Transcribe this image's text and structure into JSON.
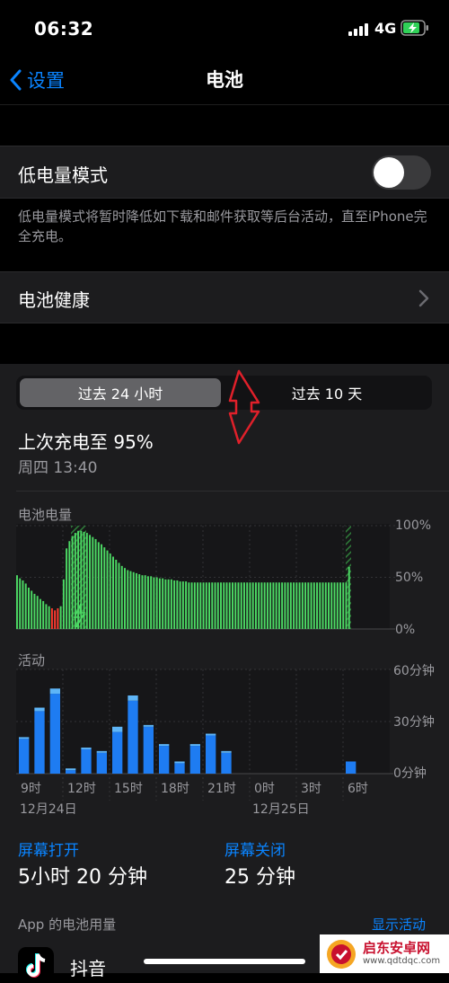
{
  "status_bar": {
    "time": "06:32",
    "network": "4G",
    "battery_icon": "battery-charging-icon",
    "battery_color": "#30d158"
  },
  "nav": {
    "back_label": "设置",
    "title": "电池",
    "accent": "#0a84ff"
  },
  "low_power": {
    "label": "低电量模式",
    "enabled": false,
    "footnote": "低电量模式将暂时降低如下载和邮件获取等后台活动，直至iPhone完全充电。"
  },
  "battery_health": {
    "label": "电池健康"
  },
  "segments": {
    "options": [
      "过去 24 小时",
      "过去 10 天"
    ],
    "selected": 0
  },
  "last_charge": {
    "title": "上次充电至 95%",
    "time": "周四 13:40"
  },
  "battery_chart": {
    "label": "电池电量",
    "y_ticks": [
      "100%",
      "50%",
      "0%"
    ],
    "colors": {
      "normal": "#4cd964",
      "low": "#ff3b30"
    },
    "chart_data": {
      "type": "bar",
      "ylim": [
        0,
        100
      ],
      "values": [
        52,
        49,
        47,
        44,
        40,
        37,
        34,
        32,
        29,
        27,
        24,
        22,
        20,
        18,
        20,
        22,
        48,
        78,
        85,
        90,
        93,
        95,
        95,
        94,
        93,
        91,
        89,
        87,
        84,
        82,
        79,
        76,
        73,
        70,
        67,
        64,
        61,
        59,
        57,
        56,
        55,
        54,
        53,
        52,
        52,
        51,
        51,
        50,
        50,
        49,
        49,
        48,
        48,
        48,
        47,
        47,
        46,
        46,
        46,
        45,
        45,
        45,
        45,
        45,
        45,
        45,
        45,
        45,
        45,
        45,
        45,
        45,
        45,
        45,
        45,
        45,
        45,
        45,
        45,
        45,
        45,
        45,
        45,
        45,
        45,
        45,
        45,
        45,
        45,
        45,
        45,
        45,
        45,
        45,
        45,
        45,
        45,
        45,
        45,
        45,
        45,
        45,
        45,
        45,
        45,
        45,
        45,
        45,
        45,
        45,
        45,
        45,
        45,
        45,
        60
      ],
      "low_threshold": 20
    }
  },
  "activity_chart": {
    "label": "活动",
    "y_ticks": [
      "60分钟",
      "30分钟",
      "0分钟"
    ],
    "colors": {
      "screen_on": "#1e7cf2",
      "screen_off": "#5eb5f7"
    },
    "x_labels": [
      "9时",
      "12时",
      "15时",
      "18时",
      "21时",
      "0时",
      "3时",
      "6时"
    ],
    "date_labels": [
      "12月24日",
      "12月25日"
    ],
    "chart_data": {
      "type": "bar",
      "ylim": [
        0,
        60
      ],
      "x": [
        "9时",
        "10时",
        "11时",
        "12时",
        "13时",
        "14时",
        "15时",
        "16时",
        "17时",
        "18时",
        "19时",
        "20时",
        "21时",
        "22时",
        "23时",
        "0时",
        "1时",
        "2时",
        "3时",
        "4时",
        "5时",
        "6时",
        "7时",
        "8时"
      ],
      "series": [
        {
          "name": "屏幕打开",
          "values": [
            20,
            36,
            46,
            2,
            14,
            12,
            24,
            42,
            27,
            16,
            6,
            16,
            22,
            12,
            0,
            0,
            0,
            0,
            0,
            0,
            0,
            7,
            0,
            0
          ]
        },
        {
          "name": "屏幕关闭",
          "values": [
            1,
            2,
            3,
            1,
            1,
            1,
            3,
            3,
            1,
            1,
            1,
            1,
            1,
            1,
            0,
            0,
            0,
            0,
            0,
            0,
            0,
            0,
            0,
            0
          ]
        }
      ]
    }
  },
  "screen_on": {
    "label": "屏幕打开",
    "value": "5小时 20 分钟"
  },
  "screen_off": {
    "label": "屏幕关闭",
    "value": "25 分钟"
  },
  "app_usage": {
    "header": "App 的电池用量",
    "show_activity": "显示活动",
    "apps": [
      {
        "name": "抖音",
        "icon": "tiktok-icon"
      }
    ]
  },
  "watermark": {
    "title": "启东安卓网",
    "url": "www.qdtdqc.com"
  }
}
